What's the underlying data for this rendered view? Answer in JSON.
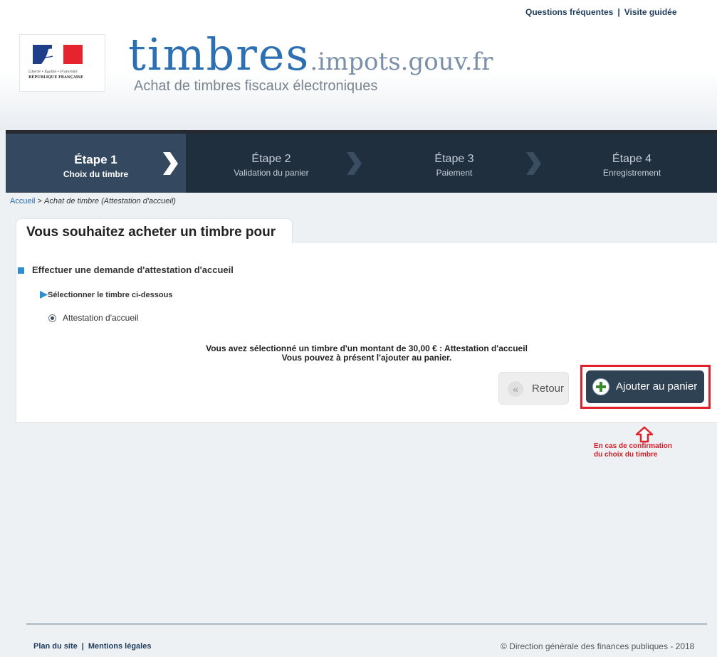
{
  "top_links": {
    "faq": "Questions fréquentes",
    "separator": "|",
    "guided_tour": "Visite guidée"
  },
  "logo": {
    "motto": "Liberté • Égalité • Fraternité",
    "republic": "RÉPUBLIQUE FRANÇAISE"
  },
  "brand": {
    "name": "timbres",
    "domain": ".impots.gouv.fr",
    "tagline": "Achat de timbres fiscaux électroniques"
  },
  "steps": [
    {
      "title": "Étape 1",
      "subtitle": "Choix du timbre",
      "active": true
    },
    {
      "title": "Étape 2",
      "subtitle": "Validation du panier",
      "active": false
    },
    {
      "title": "Étape 3",
      "subtitle": "Paiement",
      "active": false
    },
    {
      "title": "Étape 4",
      "subtitle": "Enregistrement",
      "active": false
    }
  ],
  "breadcrumb": {
    "home": "Accueil",
    "separator": " > ",
    "current": "Achat de timbre (Attestation d'accueil)"
  },
  "panel": {
    "tab_title": "Vous souhaitez acheter un timbre pour",
    "section_title": "Effectuer une demande d'attestation d'accueil",
    "select_hint": "Sélectionner le timbre ci-dessous",
    "radio_option": "Attestation d'accueil",
    "radio_checked": true,
    "message_line1": "Vous avez sélectionné un timbre d'un montant de 30,00 € : Attestation d'accueil",
    "message_line2": "Vous pouvez à présent l'ajouter au panier."
  },
  "buttons": {
    "back_label": "Retour",
    "back_icon": "«",
    "add_label": "Ajouter au panier"
  },
  "annotation": {
    "line1": "En cas de confirmation",
    "line2": "du choix du timbre"
  },
  "footer": {
    "sitemap": "Plan du site",
    "separator": "|",
    "legal": "Mentions légales",
    "copyright": "© Direction générale des finances publiques - 2018"
  },
  "colors": {
    "accent_blue": "#2d6fb3",
    "nav_dark": "#2f4254",
    "highlight_red": "#e0202a",
    "section_square": "#2e8fd0"
  },
  "icons": {
    "nav_chevron": "chevron-right-icon",
    "add": "plus-circle-icon",
    "back": "double-chevron-left-icon",
    "callout": "up-arrow-icon"
  }
}
